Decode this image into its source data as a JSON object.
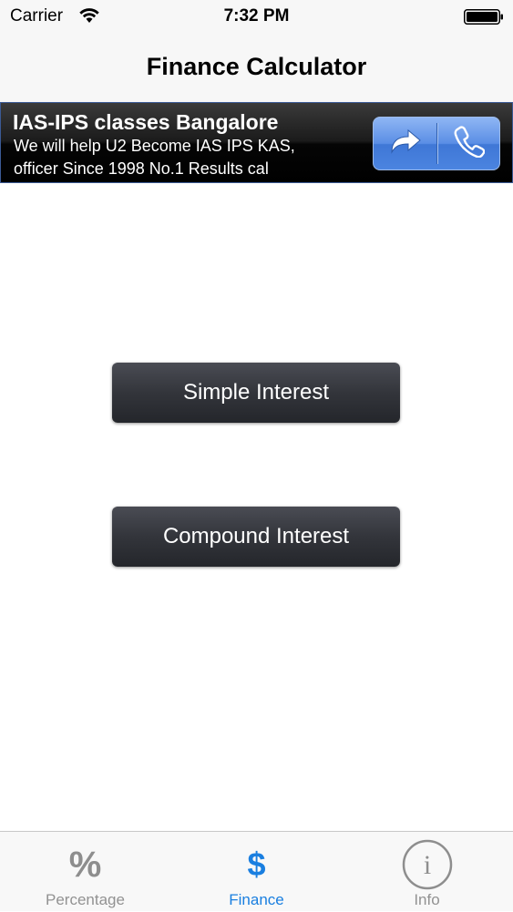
{
  "status_bar": {
    "carrier": "Carrier",
    "time": "7:32 PM",
    "wifi_icon": "wifi-icon",
    "battery_icon": "battery-icon"
  },
  "nav": {
    "title": "Finance Calculator"
  },
  "ad": {
    "title": "IAS-IPS classes Bangalore",
    "line1": "We will help U2 Become IAS IPS KAS,",
    "line2": "officer Since 1998 No.1 Results cal",
    "forward_icon": "share-arrow-icon",
    "call_icon": "phone-icon",
    "accent_color": "#4b84e0"
  },
  "main": {
    "simple_label": "Simple Interest",
    "compound_label": "Compound Interest"
  },
  "tabs": [
    {
      "label": "Percentage",
      "icon_glyph": "%",
      "icon": "percent-icon",
      "selected": false
    },
    {
      "label": "Finance",
      "icon_glyph": "$",
      "icon": "dollar-icon",
      "selected": true
    },
    {
      "label": "Info",
      "icon_glyph": "i",
      "icon": "info-icon",
      "selected": false
    }
  ],
  "colors": {
    "tab_selected": "#1a7fe0",
    "tab_unselected": "#929292",
    "button_dark": "#33353b"
  }
}
